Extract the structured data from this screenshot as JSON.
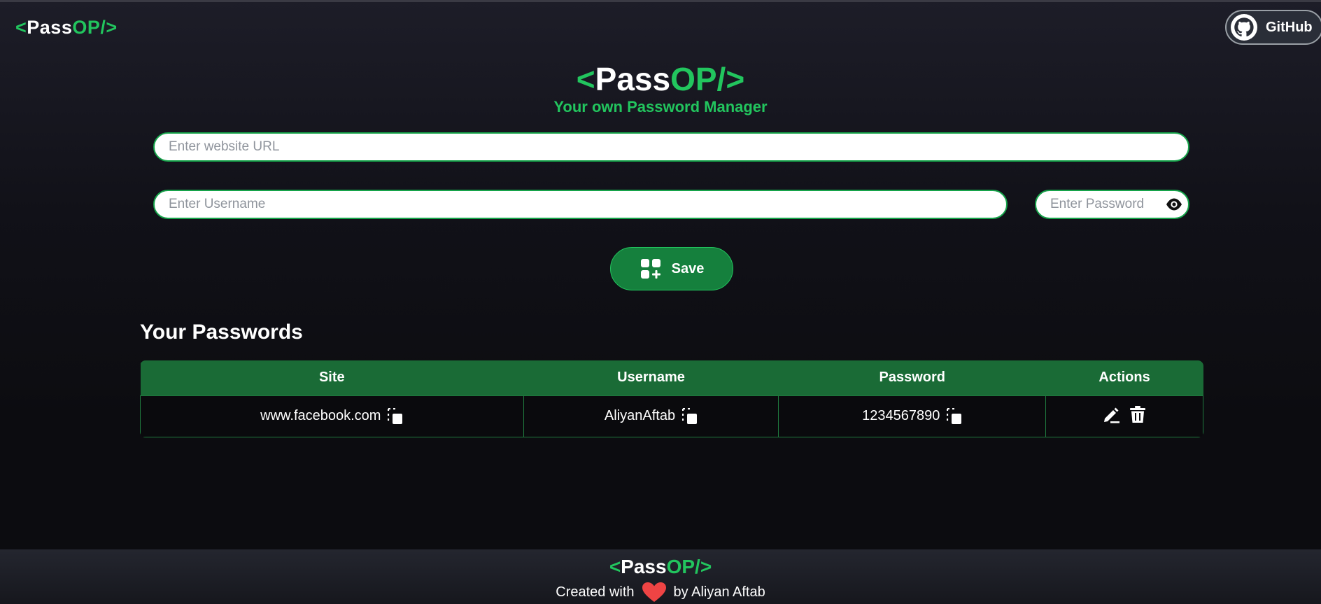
{
  "brand": {
    "lt": "<",
    "pass": "Pass",
    "op": "OP/",
    "gt": ">"
  },
  "nav": {
    "github_label": "GitHub"
  },
  "hero": {
    "subtitle": "Your own Password Manager"
  },
  "form": {
    "url_placeholder": "Enter website URL",
    "username_placeholder": "Enter Username",
    "password_placeholder": "Enter Password",
    "save_label": "Save"
  },
  "passwords": {
    "heading": "Your Passwords",
    "columns": [
      "Site",
      "Username",
      "Password",
      "Actions"
    ],
    "rows": [
      {
        "site": "www.facebook.com",
        "username": "AliyanAftab",
        "password": "1234567890"
      }
    ]
  },
  "footer": {
    "created_with": "Created with",
    "by": "by Aliyan Aftab"
  },
  "colors": {
    "accent": "#22c55e",
    "button": "#15803d",
    "table_header": "#1a6b36",
    "heart": "#ef4444"
  },
  "icons": [
    "github-icon",
    "eye-icon",
    "add-grid-icon",
    "copy-icon",
    "edit-icon",
    "trash-icon",
    "heart-icon"
  ]
}
